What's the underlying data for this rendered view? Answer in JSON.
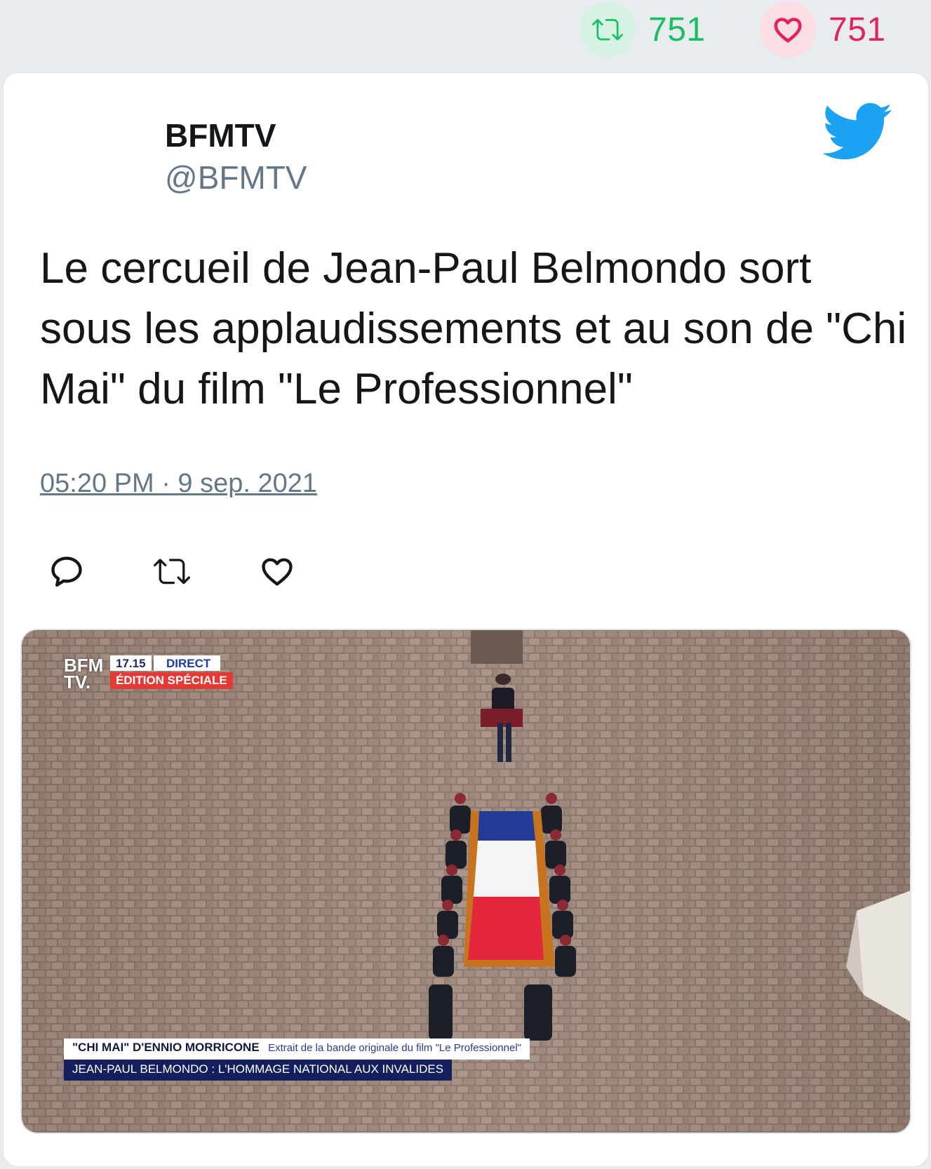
{
  "stats": {
    "retweets": "751",
    "likes": "751",
    "retweet_icon": "retweet-icon",
    "like_icon": "heart-icon"
  },
  "tweet": {
    "author_name": "BFMTV",
    "author_handle": "@BFMTV",
    "text": "Le cercueil de Jean-Paul Belmondo sort sous les applaudissements et au son de \"Chi Mai\" du film \"Le Professionnel\"",
    "timestamp": "05:20 PM · 9 sep. 2021",
    "brand_icon": "twitter-bird-icon"
  },
  "actions": [
    {
      "name": "reply",
      "icon": "reply-icon"
    },
    {
      "name": "retweet",
      "icon": "retweet-icon"
    },
    {
      "name": "like",
      "icon": "heart-icon"
    }
  ],
  "media": {
    "channel_logo_line1": "BFM",
    "channel_logo_line2": "TV.",
    "time": "17.15",
    "live": "DIRECT",
    "edition": "ÉDITION SPÉCIALE",
    "caption_strong": "\"CHI MAI\" D'ENNIO MORRICONE",
    "caption_soft": "Extrait de la bande originale du film \"Le Professionnel\"",
    "caption_bottom": "JEAN-PAUL BELMONDO : L'HOMMAGE NATIONAL AUX INVALIDES"
  },
  "colors": {
    "retweet_green": "#17bf63",
    "like_red": "#e0245e",
    "twitter_blue": "#1da1f2",
    "muted_text": "#657786"
  }
}
